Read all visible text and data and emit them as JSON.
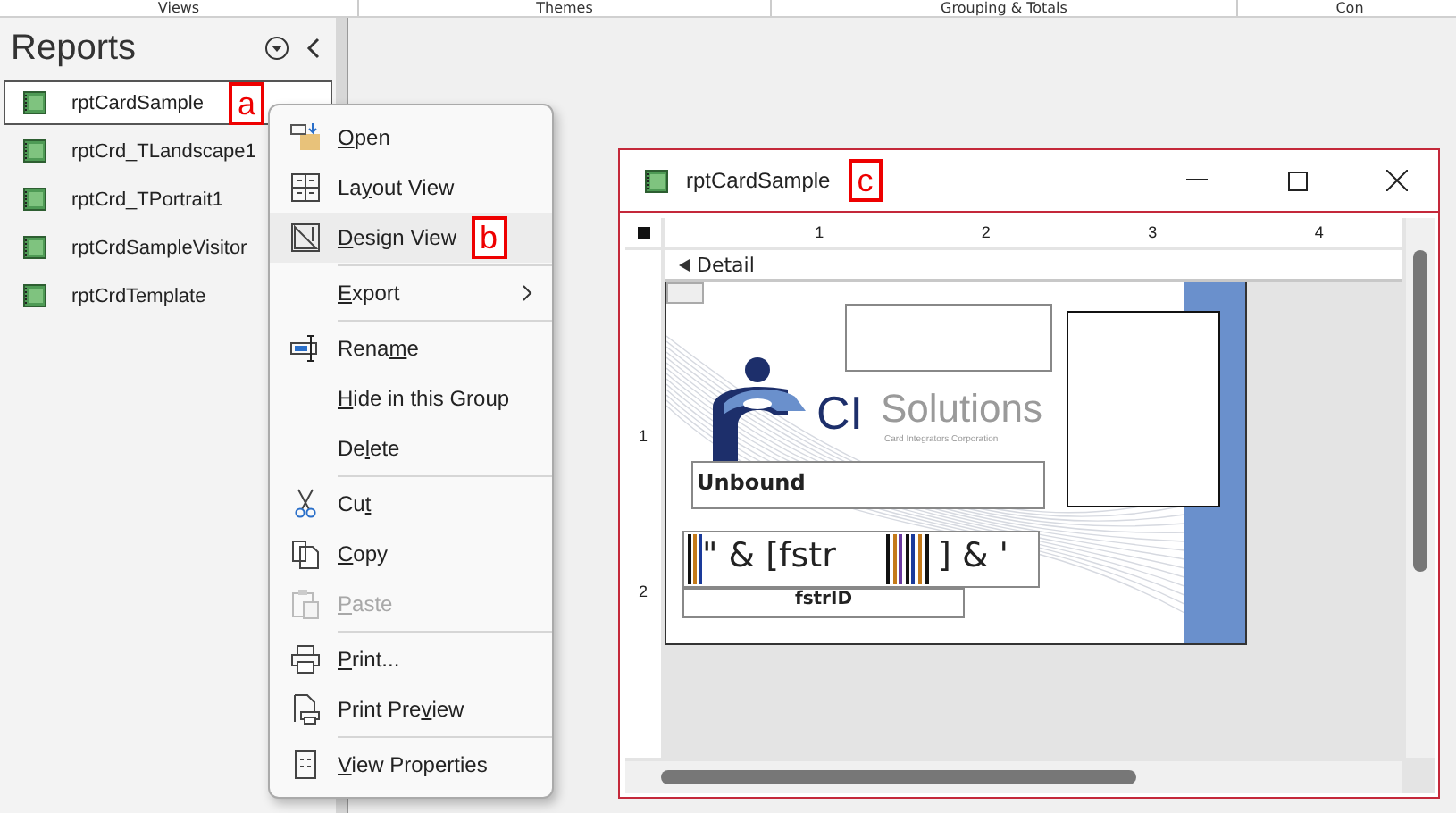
{
  "ribbon_groups": [
    "Views",
    "Themes",
    "Grouping & Totals",
    "Con"
  ],
  "nav_pane": {
    "title": "Reports",
    "items": [
      {
        "label": "rptCardSample",
        "selected": true,
        "callout": "a"
      },
      {
        "label": "rptCrd_TLandscape1",
        "selected": false
      },
      {
        "label": "rptCrd_TPortrait1",
        "selected": false
      },
      {
        "label": "rptCrdSampleVisitor",
        "selected": false
      },
      {
        "label": "rptCrdTemplate",
        "selected": false
      }
    ]
  },
  "context_menu": {
    "items": [
      {
        "kind": "item",
        "key": "O",
        "post": "pen",
        "selected": false,
        "disabled": false
      },
      {
        "kind": "item",
        "pre": "La",
        "key": "y",
        "post": "out View",
        "selected": false,
        "disabled": false
      },
      {
        "kind": "item",
        "key": "D",
        "post": "esign View",
        "selected": true,
        "disabled": false,
        "callout": "b"
      },
      {
        "kind": "separator"
      },
      {
        "kind": "submenu",
        "key": "E",
        "post": "xport",
        "selected": false,
        "disabled": false
      },
      {
        "kind": "separator"
      },
      {
        "kind": "item",
        "pre": "Rena",
        "key": "m",
        "post": "e",
        "selected": false,
        "disabled": false
      },
      {
        "kind": "item",
        "key": "H",
        "post": "ide in this Group",
        "selected": false,
        "disabled": false
      },
      {
        "kind": "item",
        "pre": "De",
        "key": "l",
        "post": "ete",
        "selected": false,
        "disabled": false
      },
      {
        "kind": "separator"
      },
      {
        "kind": "item",
        "pre": "Cu",
        "key": "t",
        "selected": false,
        "disabled": false
      },
      {
        "kind": "item",
        "key": "C",
        "post": "opy",
        "selected": false,
        "disabled": false
      },
      {
        "kind": "item",
        "key": "P",
        "post": "aste",
        "selected": false,
        "disabled": true
      },
      {
        "kind": "separator"
      },
      {
        "kind": "item",
        "key": "P",
        "post": "rint...",
        "selected": false,
        "disabled": false
      },
      {
        "kind": "item",
        "pre": "Print Pre",
        "key": "v",
        "post": "iew",
        "selected": false,
        "disabled": false
      },
      {
        "kind": "separator"
      },
      {
        "kind": "item",
        "key": "V",
        "post": "iew Properties",
        "selected": false,
        "disabled": false
      }
    ]
  },
  "design_window": {
    "title": "rptCardSample",
    "callout": "c",
    "ruler_marks": [
      "1",
      "2",
      "3",
      "4"
    ],
    "vertical_ruler_marks": [
      "1",
      "2"
    ],
    "section": "Detail",
    "logo": {
      "mark": "CI",
      "name": "Solutions",
      "tagline": "Card Integrators Corporation"
    },
    "unbound_field": "Unbound",
    "barcode_field": {
      "start": "\" & [fstr",
      "end": "] & '"
    },
    "id_label": "fstrID"
  }
}
